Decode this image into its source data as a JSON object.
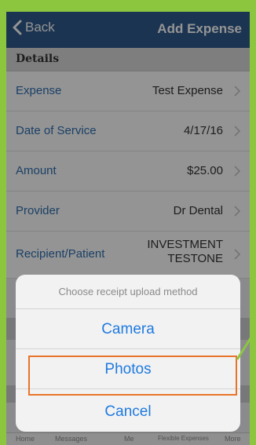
{
  "nav": {
    "back_label": "Back",
    "title": "Add Expense"
  },
  "section": {
    "title": "Details"
  },
  "rows": [
    {
      "label": "Expense",
      "value": "Test Expense"
    },
    {
      "label": "Date of Service",
      "value": "4/17/16"
    },
    {
      "label": "Amount",
      "value": "$25.00"
    },
    {
      "label": "Provider",
      "value": "Dr Dental"
    },
    {
      "label": "Recipient/Patient",
      "value": "INVESTMENT TESTONE"
    }
  ],
  "action_sheet": {
    "title": "Choose receipt upload method",
    "options": [
      "Camera",
      "Photos",
      "Cancel"
    ]
  },
  "tabbar": {
    "items": [
      "Home",
      "Messages",
      "Me",
      "Flexible Expenses",
      "More"
    ]
  },
  "colors": {
    "nav": "#2f5b8c",
    "accent": "#1f7ae0",
    "highlight": "#e8742a",
    "frame": "#8cc63f"
  }
}
